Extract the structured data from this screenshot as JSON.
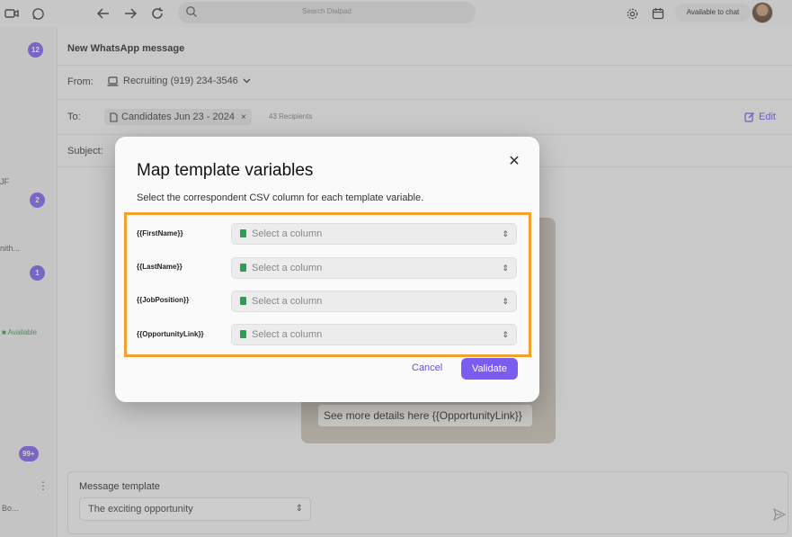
{
  "topbar": {
    "search_placeholder": "Search Dialpad",
    "status_label": "Available to chat",
    "icons": [
      "video-icon",
      "whatsapp-icon",
      "back-arrow-icon",
      "forward-arrow-icon",
      "refresh-icon",
      "search-icon",
      "gear-icon",
      "calendar-icon"
    ]
  },
  "sidebar": {
    "badges": [
      "12",
      "2",
      "1",
      "99+"
    ],
    "text_fragments": [
      "JF",
      "nith...",
      "Bo..."
    ],
    "status": "Available"
  },
  "composer": {
    "title": "New WhatsApp message",
    "from_label": "From:",
    "from_value": "Recruiting (919) 234-3546",
    "to_label": "To:",
    "to_chip": "Candidates Jun 23 - 2024",
    "recipients": "43 Recipients",
    "edit_label": "Edit",
    "subject_label": "Subject:",
    "preview_text": "See more details here {{OpportunityLink}}",
    "template_label": "Message template",
    "template_value": "The exciting opportunity"
  },
  "modal": {
    "title": "Map template variables",
    "subtitle": "Select the correspondent CSV column for each template variable.",
    "variables": [
      {
        "label": "{{FirstName}}",
        "placeholder": "Select a column"
      },
      {
        "label": "{{LastName}}",
        "placeholder": "Select a column"
      },
      {
        "label": "{{JobPosition}}",
        "placeholder": "Select a column"
      },
      {
        "label": "{{OpportunityLink}}",
        "placeholder": "Select a column"
      }
    ],
    "cancel_label": "Cancel",
    "validate_label": "Validate"
  },
  "colors": {
    "accent": "#7c5cf0",
    "highlight": "#f2a22c",
    "sheet_icon": "#2f9d57",
    "available": "#2f9a4a"
  }
}
